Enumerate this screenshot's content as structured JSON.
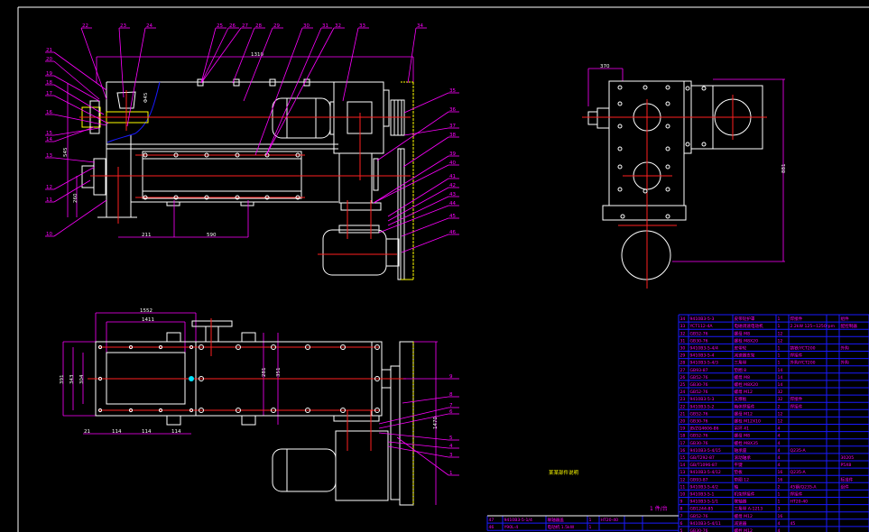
{
  "drawing": {
    "note_title": "某某部件说明",
    "quantity_note": "1 件/台",
    "colors": {
      "background": "#000000",
      "outline": "#ffffff",
      "center": "#ff2020",
      "leader": "#ff00ff",
      "highlight": "#ffff00",
      "table": "#1a1aff"
    }
  },
  "front_view": {
    "top_labels": [
      "22",
      "23",
      "24",
      "25",
      "26",
      "27",
      "28",
      "29",
      "30",
      "31",
      "32",
      "33",
      "34"
    ],
    "left_labels": [
      "21",
      "20",
      "19",
      "18",
      "17",
      "16",
      "15",
      "14",
      "13",
      "12",
      "11",
      "10"
    ],
    "right_labels": [
      "35",
      "36",
      "37",
      "38",
      "39",
      "40",
      "41",
      "42",
      "43",
      "44",
      "45",
      "46"
    ],
    "dims": {
      "overall_length": "1310",
      "bottom_a": "211",
      "bottom_b": "590",
      "height": "545",
      "shaft_height": "260",
      "shaft_dia": "Φ45"
    }
  },
  "side_view": {
    "dims": {
      "width": "370",
      "height": "881"
    }
  },
  "plan_view": {
    "right_labels": [
      "9",
      "8",
      "7",
      "6",
      "5",
      "4",
      "3",
      "1"
    ],
    "dims": {
      "outer": "1552",
      "inner": "1411",
      "v1": "391",
      "v2": "343",
      "v3": "304",
      "mid1": "281",
      "mid2": "351",
      "right": "1470",
      "b1": "21",
      "b2": "114",
      "b3": "114",
      "b4": "114"
    }
  },
  "parts_table": {
    "rows": [
      [
        "34",
        "9410B3-5-3",
        "皮带轮护罩",
        "1",
        "焊接件",
        "",
        "组件"
      ],
      [
        "33",
        "YCT112-4A",
        "电磁调速电动机",
        "1",
        "2.2kW 125~1250rpm",
        "",
        "配控制器"
      ],
      [
        "32",
        "GB52-76",
        "螺母 M8",
        "12",
        "",
        "",
        ""
      ],
      [
        "31",
        "GB30-76",
        "螺栓 M8X20",
        "12",
        "",
        "",
        ""
      ],
      [
        "30",
        "9410B3-5-4/4",
        "皮带轮",
        "1",
        "铸铁/YCT200",
        "",
        "外购"
      ],
      [
        "29",
        "9410B3-5-4",
        "减速器支架",
        "1",
        "焊接件",
        "",
        ""
      ],
      [
        "28",
        "9410B3-5-4/3",
        "三角带",
        "1",
        "外购/YCT200",
        "",
        "外购"
      ],
      [
        "27",
        "GB93-87",
        "垫圈 8",
        "14",
        "",
        "",
        ""
      ],
      [
        "26",
        "GB52-76",
        "螺母 M8",
        "14",
        "",
        "",
        ""
      ],
      [
        "25",
        "GB30-76",
        "螺栓 M8X20",
        "14",
        "",
        "",
        ""
      ],
      [
        "24",
        "GB52-76",
        "螺母 M12",
        "32",
        "",
        "",
        ""
      ],
      [
        "23",
        "9410B3-5-3",
        "支撑板",
        "32",
        "焊接件",
        "",
        ""
      ],
      [
        "22",
        "9410B3-5-2",
        "箱体焊接件",
        "2",
        "焊接件",
        "",
        ""
      ],
      [
        "21",
        "GB52-76",
        "螺母 M12",
        "12",
        "",
        "",
        ""
      ],
      [
        "20",
        "GB30-76",
        "螺栓 M12X10",
        "12",
        "",
        "",
        ""
      ],
      [
        "19",
        "JB/ZQ4606-86",
        "吊环 41",
        "4",
        "",
        "",
        ""
      ],
      [
        "18",
        "GB52-76",
        "螺母 M8",
        "4",
        "",
        "",
        ""
      ],
      [
        "17",
        "GB30-76",
        "螺栓 M8X35",
        "4",
        "",
        "",
        ""
      ],
      [
        "16",
        "9410B3-5-4/15",
        "轴承座",
        "4",
        "Q235-A",
        "",
        ""
      ],
      [
        "15",
        "GB/T292-87",
        "滚动轴承",
        "4",
        "",
        "",
        "30205"
      ],
      [
        "14",
        "GB/T1096-87",
        "平键",
        "4",
        "",
        "",
        "P5X8"
      ],
      [
        "13",
        "9410B3-5-4/12",
        "垫板",
        "16",
        "Q235-A",
        "",
        ""
      ],
      [
        "12",
        "GB93-87",
        "垫圈 12",
        "16",
        "",
        "",
        "标准件"
      ],
      [
        "11",
        "9410B3-5-4/2",
        "轴",
        "2",
        "45钢/Q235-A",
        "",
        "组件"
      ],
      [
        "10",
        "9410B3-5-1",
        "机架焊接件",
        "1",
        "焊接件",
        "",
        ""
      ],
      [
        "9",
        "9410B3-5-1/1",
        "联轴器",
        "1",
        "HT20-40",
        "",
        ""
      ],
      [
        "8",
        "GB1244-85",
        "三角带 A-1213",
        "3",
        "",
        "",
        ""
      ],
      [
        "7",
        "GB52-76",
        "螺母 M12",
        "16",
        "",
        "",
        ""
      ],
      [
        "6",
        "9410B3-5-4/11",
        "减速器",
        "4",
        "45",
        "",
        ""
      ],
      [
        "5",
        "GB30-76",
        "螺栓 M12",
        "4",
        "",
        "",
        ""
      ]
    ],
    "extra_rows": [
      [
        "47",
        "9410B3-5-1/4",
        "联轴器盖",
        "1",
        "HT20-40",
        "",
        ""
      ],
      [
        "46",
        "Y90L-4",
        "电动机 1.5kW",
        "1",
        "",
        "",
        ""
      ]
    ]
  }
}
